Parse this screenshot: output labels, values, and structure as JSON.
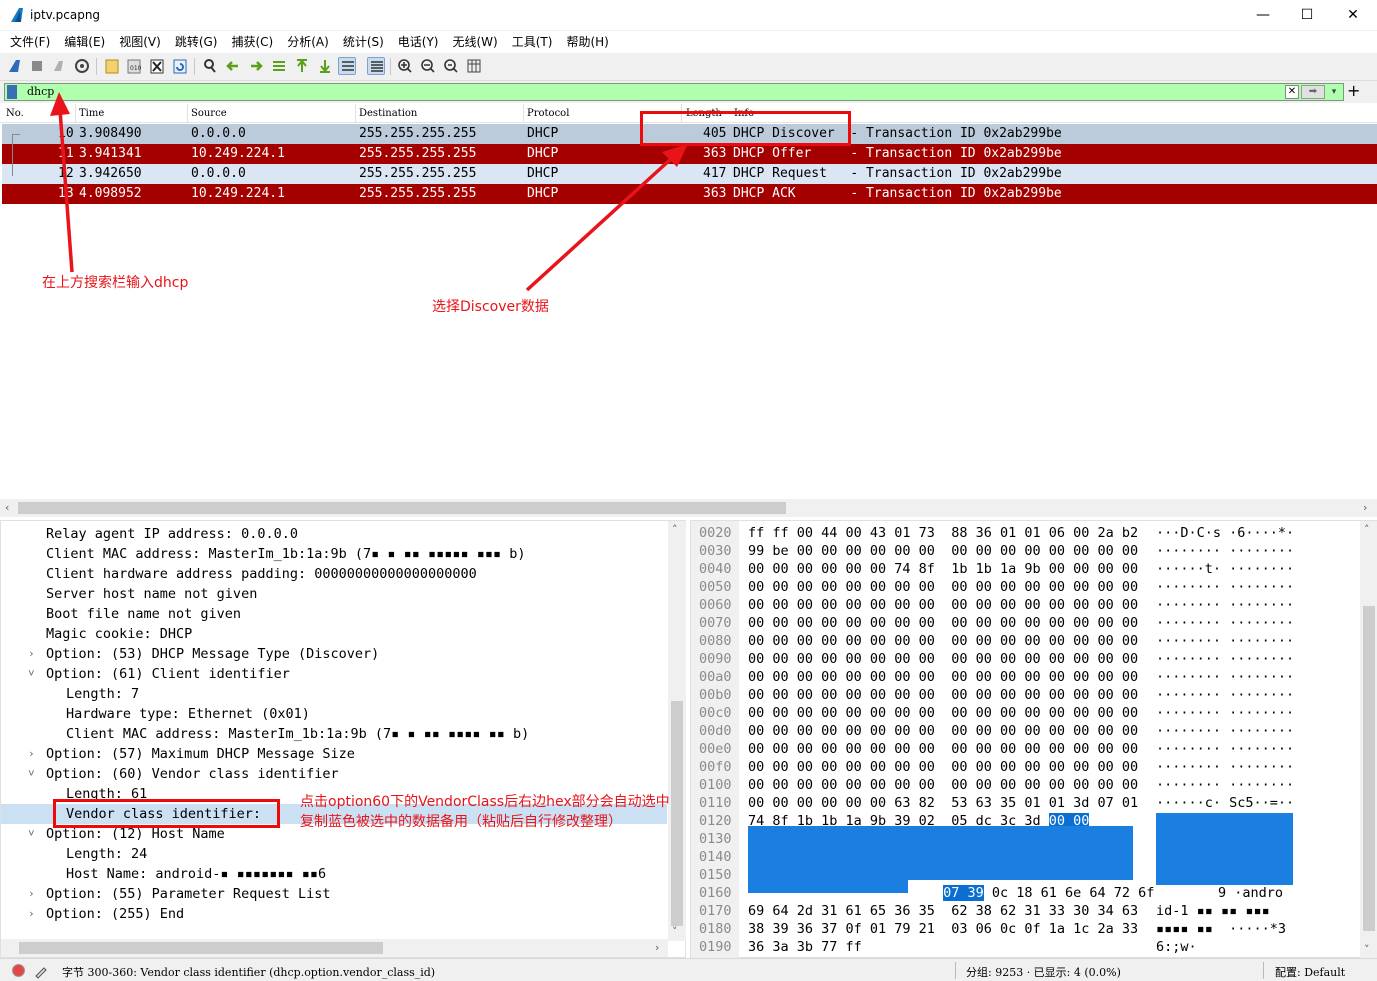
{
  "window": {
    "title": "iptv.pcapng",
    "controls": {
      "minimize": "—",
      "maximize": "☐",
      "close": "✕"
    }
  },
  "menu": [
    "文件(F)",
    "编辑(E)",
    "视图(V)",
    "跳转(G)",
    "捕获(C)",
    "分析(A)",
    "统计(S)",
    "电话(Y)",
    "无线(W)",
    "工具(T)",
    "帮助(H)"
  ],
  "filter": {
    "value": "dhcp",
    "add": "+"
  },
  "packet_list": {
    "headers": [
      "No.",
      "Time",
      "Source",
      "Destination",
      "Protocol",
      "Length",
      "Info"
    ],
    "rows": [
      {
        "no": "10",
        "time": "3.908490",
        "src": "0.0.0.0",
        "dst": "255.255.255.255",
        "proto": "DHCP",
        "len": "405",
        "info": "DHCP Discover  - Transaction ID 0x2ab299be"
      },
      {
        "no": "11",
        "time": "3.941341",
        "src": "10.249.224.1",
        "dst": "255.255.255.255",
        "proto": "DHCP",
        "len": "363",
        "info": "DHCP Offer     - Transaction ID 0x2ab299be"
      },
      {
        "no": "12",
        "time": "3.942650",
        "src": "0.0.0.0",
        "dst": "255.255.255.255",
        "proto": "DHCP",
        "len": "417",
        "info": "DHCP Request   - Transaction ID 0x2ab299be"
      },
      {
        "no": "13",
        "time": "4.098952",
        "src": "10.249.224.1",
        "dst": "255.255.255.255",
        "proto": "DHCP",
        "len": "363",
        "info": "DHCP ACK       - Transaction ID 0x2ab299be"
      }
    ]
  },
  "details": {
    "lines": [
      {
        "indent": 0,
        "expander": "",
        "text": "Relay agent IP address: 0.0.0.0"
      },
      {
        "indent": 0,
        "expander": "",
        "text": "Client MAC address: MasterIm_1b:1a:9b (7▪ ▪ ▪▪ ▪▪▪▪▪ ▪▪▪ b)"
      },
      {
        "indent": 0,
        "expander": "",
        "text": "Client hardware address padding: 00000000000000000000"
      },
      {
        "indent": 0,
        "expander": "",
        "text": "Server host name not given"
      },
      {
        "indent": 0,
        "expander": "",
        "text": "Boot file name not given"
      },
      {
        "indent": 0,
        "expander": "",
        "text": "Magic cookie: DHCP"
      },
      {
        "indent": 0,
        "expander": "›",
        "text": "Option: (53) DHCP Message Type (Discover)"
      },
      {
        "indent": 0,
        "expander": "˅",
        "text": "Option: (61) Client identifier"
      },
      {
        "indent": 1,
        "expander": "",
        "text": "Length: 7"
      },
      {
        "indent": 1,
        "expander": "",
        "text": "Hardware type: Ethernet (0x01)"
      },
      {
        "indent": 1,
        "expander": "",
        "text": "Client MAC address: MasterIm_1b:1a:9b (7▪ ▪ ▪▪ ▪▪▪▪ ▪▪ b)"
      },
      {
        "indent": 0,
        "expander": "›",
        "text": "Option: (57) Maximum DHCP Message Size"
      },
      {
        "indent": 0,
        "expander": "˅",
        "text": "Option: (60) Vendor class identifier"
      },
      {
        "indent": 1,
        "expander": "",
        "text": "Length: 61"
      },
      {
        "indent": 1,
        "expander": "",
        "text": "Vendor class identifier:"
      },
      {
        "indent": 0,
        "expander": "˅",
        "text": "Option: (12) Host Name"
      },
      {
        "indent": 1,
        "expander": "",
        "text": "Length: 24"
      },
      {
        "indent": 1,
        "expander": "",
        "text": "Host Name: android-▪ ▪▪▪▪▪▪▪ ▪▪6"
      },
      {
        "indent": 0,
        "expander": "›",
        "text": "Option: (55) Parameter Request List"
      },
      {
        "indent": 0,
        "expander": "›",
        "text": "Option: (255) End"
      }
    ]
  },
  "bytes": {
    "rows": [
      {
        "off": "0020",
        "hex": "ff ff 00 44 00 43 01 73  88 36 01 01 06 00 2a b2",
        "asc": "···D·C·s ·6····*·"
      },
      {
        "off": "0030",
        "hex": "99 be 00 00 00 00 00 00  00 00 00 00 00 00 00 00",
        "asc": "········ ········"
      },
      {
        "off": "0040",
        "hex": "00 00 00 00 00 00 74 8f  1b 1b 1a 9b 00 00 00 00",
        "asc": "······t· ········"
      },
      {
        "off": "0050",
        "hex": "00 00 00 00 00 00 00 00  00 00 00 00 00 00 00 00",
        "asc": "········ ········"
      },
      {
        "off": "0060",
        "hex": "00 00 00 00 00 00 00 00  00 00 00 00 00 00 00 00",
        "asc": "········ ········"
      },
      {
        "off": "0070",
        "hex": "00 00 00 00 00 00 00 00  00 00 00 00 00 00 00 00",
        "asc": "········ ········"
      },
      {
        "off": "0080",
        "hex": "00 00 00 00 00 00 00 00  00 00 00 00 00 00 00 00",
        "asc": "········ ········"
      },
      {
        "off": "0090",
        "hex": "00 00 00 00 00 00 00 00  00 00 00 00 00 00 00 00",
        "asc": "········ ········"
      },
      {
        "off": "00a0",
        "hex": "00 00 00 00 00 00 00 00  00 00 00 00 00 00 00 00",
        "asc": "········ ········"
      },
      {
        "off": "00b0",
        "hex": "00 00 00 00 00 00 00 00  00 00 00 00 00 00 00 00",
        "asc": "········ ········"
      },
      {
        "off": "00c0",
        "hex": "00 00 00 00 00 00 00 00  00 00 00 00 00 00 00 00",
        "asc": "········ ········"
      },
      {
        "off": "00d0",
        "hex": "00 00 00 00 00 00 00 00  00 00 00 00 00 00 00 00",
        "asc": "········ ········"
      },
      {
        "off": "00e0",
        "hex": "00 00 00 00 00 00 00 00  00 00 00 00 00 00 00 00",
        "asc": "········ ········"
      },
      {
        "off": "00f0",
        "hex": "00 00 00 00 00 00 00 00  00 00 00 00 00 00 00 00",
        "asc": "········ ········"
      },
      {
        "off": "0100",
        "hex": "00 00 00 00 00 00 00 00  00 00 00 00 00 00 00 00",
        "asc": "········ ········"
      },
      {
        "off": "0110",
        "hex": "00 00 00 00 00 00 63 82  53 63 35 01 01 3d 07 01",
        "asc": "······c· Sc5··=··"
      },
      {
        "off": "0120",
        "hex": "74 8f 1b 1b 1a 9b 39 02  05 dc 3c 3d ",
        "hex_sel": "00 00",
        "asc": "t····9· ·<="
      },
      {
        "off": "0130",
        "hex": "",
        "asc": ""
      },
      {
        "off": "0140",
        "hex": "",
        "asc": ""
      },
      {
        "off": "0150",
        "hex": "",
        "asc": ""
      },
      {
        "off": "0160",
        "hex": "",
        "hex_sel": "07 39",
        "hex_tail": " 0c 18 61 6e 64 72 6f",
        "asc": "9 ·andro"
      },
      {
        "off": "0170",
        "hex": "69 64 2d 31 61 65 36 35  62 38 62 31 33 30 34 63",
        "asc": "id-1 ▪▪ ▪▪ ▪▪▪"
      },
      {
        "off": "0180",
        "hex": "38 39 36 37 0f 01 79 21  03 06 0c 0f 1a 1c 2a 33",
        "asc": "▪▪▪▪ ▪▪  ·····*3"
      },
      {
        "off": "0190",
        "hex": "36 3a 3b 77 ff",
        "asc": "6:;w·"
      }
    ]
  },
  "status": {
    "bytes_info": "字节 300-360: Vendor class identifier (dhcp.option.vendor_class_id)",
    "packets": "分组: 9253 · 已显示: 4 (0.0%)",
    "profile": "配置: Default"
  },
  "annotations": {
    "search_hint": "在上方搜索栏输入dhcp",
    "discover_hint": "选择Discover数据",
    "vendor_hint_1": "点击option60下的VendorClass后右边hex部分会自动选中",
    "vendor_hint_2": "复制蓝色被选中的数据备用（粘贴后自行修改整理）"
  },
  "colors": {
    "filter_valid": "#afffaf",
    "row_selected": "#bccbdb",
    "row_dark_red": "#a40000",
    "row_light_blue": "#dae6f4",
    "hex_highlight": "#0a6fd0",
    "annotation_red": "#e8141a"
  }
}
